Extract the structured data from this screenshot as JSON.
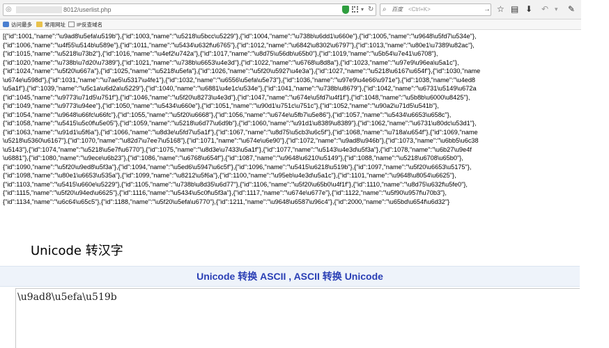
{
  "browser": {
    "url": "8012/userlist.php",
    "search_engine": "百度",
    "search_placeholder": "<Ctrl+K>",
    "bookmarks": [
      "访问最多",
      "常用网址",
      "IP反查域名"
    ]
  },
  "json_lines": [
    "[{\"id\":1001,\"name\":\"\\u9ad8\\u5efa\\u519b\"},{\"id\":1003,\"name\":\"\\u5218\\u5bcc\\u5229\"},{\"id\":1004,\"name\":\"\\u738b\\u6dd1\\u660e\"},{\"id\":1005,\"name\":\"\\u9648\\u5fd7\\u534e\"},",
    "{\"id\":1006,\"name\":\"\\u4f55\\u514b\\u589e\"},{\"id\":1011,\"name\":\"\\u5434\\u632f\\u6765\"},{\"id\":1012,\"name\":\"\\u6842\\u8302\\u6797\"},{\"id\":1013,\"name\":\"\\u80e1\\u7389\\u82ac\"},",
    "{\"id\":1015,\"name\":\"\\u5218\\u73b2\"},{\"id\":1016,\"name\":\"\\u4ef2\\u742a\"},{\"id\":1017,\"name\":\"\\u8d75\\u56db\\u65b0\"},{\"id\":1019,\"name\":\"\\u5b54\\u7e41\\u6708\"},",
    "{\"id\":1020,\"name\":\"\\u738b\\u7d20\\u7389\"},{\"id\":1021,\"name\":\"\\u738b\\u6653\\u4e3d\"},{\"id\":1022,\"name\":\"\\u6768\\u8d8a\"},{\"id\":1023,\"name\":\"\\u97e9\\u96ea\\u5a1c\"},",
    "{\"id\":1024,\"name\":\"\\u5f20\\u667a\"},{\"id\":1025,\"name\":\"\\u5218\\u5efa\"},{\"id\":1026,\"name\":\"\\u5f20\\u5927\\u4e3a\"},{\"id\":1027,\"name\":\"\\u5218\\u6167\\u654f\"},{\"id\":1030,\"name",
    "\\u674e\\u598d\"},{\"id\":1031,\"name\":\"\\u7ae5\\u5317\\u4fe1\"},{\"id\":1032,\"name\":\"\\u6556\\u5efa\\u5e73\"},{\"id\":1036,\"name\":\"\\u97e9\\u4e66\\u971e\"},{\"id\":1038,\"name\":\"\\u4ed8",
    "\\u5a1f\"},{\"id\":1039,\"name\":\"\\u5c1a\\u6d2a\\u5229\"},{\"id\":1040,\"name\":\"\\u6881\\u4e1c\\u534e\"},{\"id\":1041,\"name\":\"\\u738b\\u8679\"},{\"id\":1042,\"name\":\"\\u6731\\u5149\\u672a",
    "{\"id\":1045,\"name\":\"\\u9773\\u71d5\\u751f\"},{\"id\":1046,\"name\":\"\\u5f20\\u8273\\u4e3d\"},{\"id\":1047,\"name\":\"\\u674e\\u5fd7\\u4f1f\"},{\"id\":1048,\"name\":\"\\u5b8b\\u6000\\u8425\"},",
    "{\"id\":1049,\"name\":\"\\u9773\\u94ee\"},{\"id\":1050,\"name\":\"\\u5434\\u660e\"},{\"id\":1051,\"name\":\"\\u90d1\\u751c\\u751c\"},{\"id\":1052,\"name\":\"\\u90a2\\u71d5\\u541b\"},",
    "{\"id\":1054,\"name\":\"\\u9648\\u66fc\\u66fc\"},{\"id\":1055,\"name\":\"\\u5f20\\u6668\"},{\"id\":1056,\"name\":\"\\u674e\\u5fb7\\u5e86\"},{\"id\":1057,\"name\":\"\\u5434\\u6653\\u658c\"},",
    "{\"id\":1058,\"name\":\"\\u5415\\u5c0f\\u5e05\"},{\"id\":1059,\"name\":\"\\u5218\\u6d77\\u6d9b\"},{\"id\":1060,\"name\":\"\\u91d1\\u8389\\u8389\"},{\"id\":1062,\"name\":\"\\u6731\\u80dc\\u53d1\"},",
    "{\"id\":1063,\"name\":\"\\u91d1\\u5f6a\"},{\"id\":1066,\"name\":\"\\u8d3e\\u5fd7\\u5a1f\"},{\"id\":1067,\"name\":\"\\u8d75\\u5cb3\\u6c5f\"},{\"id\":1068,\"name\":\"\\u718a\\u654f\"},{\"id\":1069,\"name",
    "\\u5218\\u5360\\u6167\"},{\"id\":1070,\"name\":\"\\u82d7\\u7ee7\\u5168\"},{\"id\":1071,\"name\":\"\\u674e\\u6e90\"},{\"id\":1072,\"name\":\"\\u9ad8\\u946b\"},{\"id\":1073,\"name\":\"\\u6bb5\\u6c38",
    "\\u5143\"},{\"id\":1074,\"name\":\"\\u5218\\u5e7f\\u6770\"},{\"id\":1075,\"name\":\"\\u8d3e\\u7433\\u5a1f\"},{\"id\":1077,\"name\":\"\\u5143\\u4e3d\\u5f3a\"},{\"id\":1078,\"name\":\"\\u6b27\\u9e4f",
    "\\u6881\"},{\"id\":1080,\"name\":\"\\u9ece\\u6b23\"},{\"id\":1086,\"name\":\"\\u6768\\u654f\"},{\"id\":1087,\"name\":\"\\u9648\\u6210\\u5149\"},{\"id\":1088,\"name\":\"\\u5218\\u6708\\u65b0\"},",
    "{\"id\":1090,\"name\":\"\\u5f20\\u9ed8\\u5f3a\"},{\"id\":1094,\"name\":\"\\u5ed6\\u5947\\u6c5f\"},{\"id\":1096,\"name\":\"\\u5415\\u6218\\u519b\"},{\"id\":1097,\"name\":\"\\u5f20\\u6653\\u5175\"},",
    "{\"id\":1098,\"name\":\"\\u80e1\\u6653\\u535a\"},{\"id\":1099,\"name\":\"\\u8212\\u5f6a\"},{\"id\":1100,\"name\":\"\\u95eb\\u4e3d\\u5a1c\"},{\"id\":1101,\"name\":\"\\u9648\\u8054\\u6625\"},",
    "{\"id\":1103,\"name\":\"\\u5415\\u660e\\u5229\"},{\"id\":1105,\"name\":\"\\u738b\\u8d35\\u6d77\"},{\"id\":1106,\"name\":\"\\u5f20\\u65b0\\u4f1f\"},{\"id\":1110,\"name\":\"\\u8d75\\u632f\\u5fe0\"},",
    "{\"id\":1115,\"name\":\"\\u5f20\\u94ed\\u6625\"},{\"id\":1116,\"name\":\"\\u5434\\u5c0f\\u5f3a\"},{\"id\":1117,\"name\":\"\\u674e\\u677e\"},{\"id\":1122,\"name\":\"\\u5f90\\u957f\\u70b3\"},",
    "{\"id\":1134,\"name\":\"\\u6c64\\u65c5\"},{\"id\":1188,\"name\":\"\\u5f20\\u5efa\\u6770\"},{\"id\":1211,\"name\":\"\\u9648\\u6587\\u96c4\"},{\"id\":2000,\"name\":\"\\u65bd\\u654f\\u6d32\"}"
  ],
  "heading": "Unicode 转汉字",
  "tool_title": "Unicode 转换 ASCII , ASCII 转换 Unicode",
  "textarea_value": "\\u9ad8\\u5efa\\u519b"
}
